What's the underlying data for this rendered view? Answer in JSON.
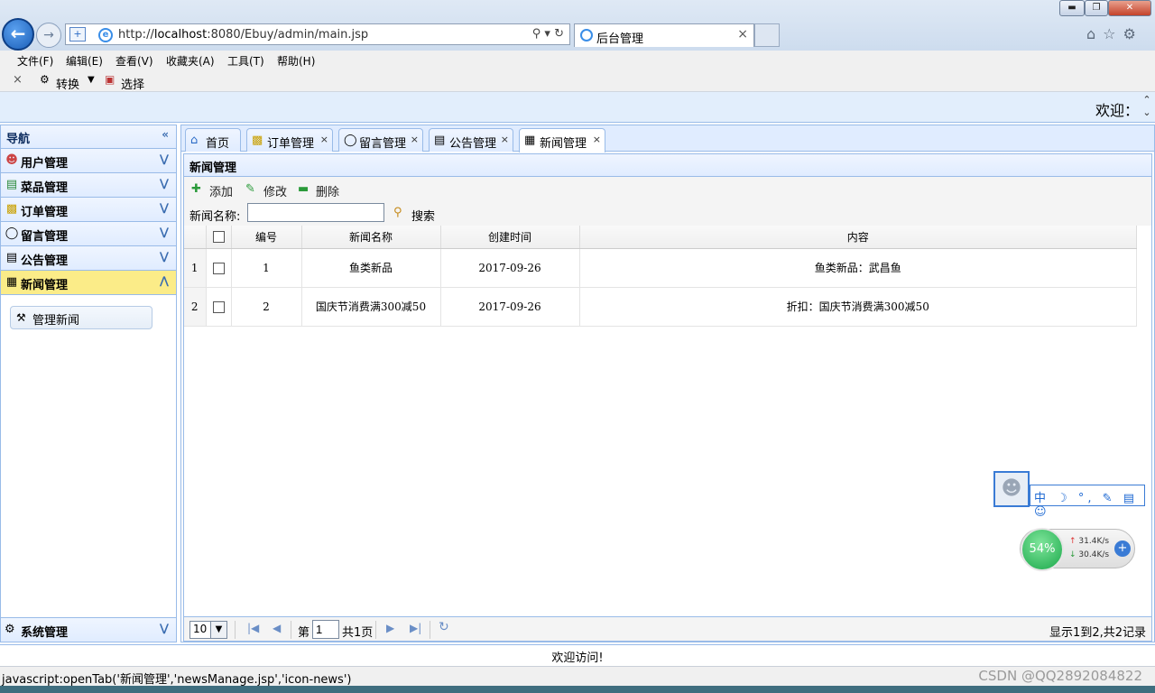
{
  "browser": {
    "url_prefix": "http://",
    "url_host": "localhost",
    "url_rest": ":8080/Ebuy/admin/main.jsp",
    "tab_title": "后台管理",
    "status_text": "javascript:openTab('新闻管理','newsManage.jsp','icon-news')",
    "menu": [
      "文件(F)",
      "编辑(E)",
      "查看(V)",
      "收藏夹(A)",
      "工具(T)",
      "帮助(H)"
    ],
    "cmd_convert": "转换",
    "cmd_select": "选择"
  },
  "header": {
    "welcome": "欢迎："
  },
  "nav": {
    "title": "导航",
    "sections": [
      {
        "label": "用户管理",
        "icon": "user-icon"
      },
      {
        "label": "菜品管理",
        "icon": "list-icon"
      },
      {
        "label": "订单管理",
        "icon": "folder-icon"
      },
      {
        "label": "留言管理",
        "icon": "comment-icon"
      },
      {
        "label": "公告管理",
        "icon": "notice-icon"
      },
      {
        "label": "新闻管理",
        "icon": "news-icon"
      }
    ],
    "subitem": "管理新闻",
    "footer": "系统管理"
  },
  "tabs": [
    {
      "label": "首页",
      "icon": "home-icon",
      "closable": false
    },
    {
      "label": "订单管理",
      "icon": "folder-icon",
      "closable": true
    },
    {
      "label": "留言管理",
      "icon": "comment-icon",
      "closable": true
    },
    {
      "label": "公告管理",
      "icon": "notice-icon",
      "closable": true
    },
    {
      "label": "新闻管理",
      "icon": "news-icon",
      "closable": true
    }
  ],
  "panel": {
    "title": "新闻管理",
    "add": "添加",
    "edit": "修改",
    "delete": "删除",
    "search_label": "新闻名称:",
    "search_value": "",
    "search_button": "搜索"
  },
  "grid": {
    "columns": [
      "编号",
      "新闻名称",
      "创建时间",
      "内容"
    ],
    "rows": [
      {
        "rownum": "1",
        "id": "1",
        "name": "鱼类新品",
        "created": "2017-09-26",
        "content": "鱼类新品：武昌鱼"
      },
      {
        "rownum": "2",
        "id": "2",
        "name": "国庆节消费满300减50",
        "created": "2017-09-26",
        "content": "折扣：国庆节消费满300减50"
      }
    ]
  },
  "pager": {
    "page_size": "10",
    "page_label": "第",
    "page_num": "1",
    "page_total": "共1页",
    "info": "显示1到2,共2记录"
  },
  "footer": {
    "text": "欢迎访问!"
  },
  "widgets": {
    "speed_percent": "54%",
    "up": "31.4K/s",
    "down": "30.4K/s",
    "ime": "中 ☽ °, ✎ ▤ ☺"
  },
  "watermark": "CSDN @QQ2892084822",
  "colors": {
    "accent": "#99bbe8",
    "selected_nav": "#fbec88",
    "header_bg": "#e0ecff"
  }
}
